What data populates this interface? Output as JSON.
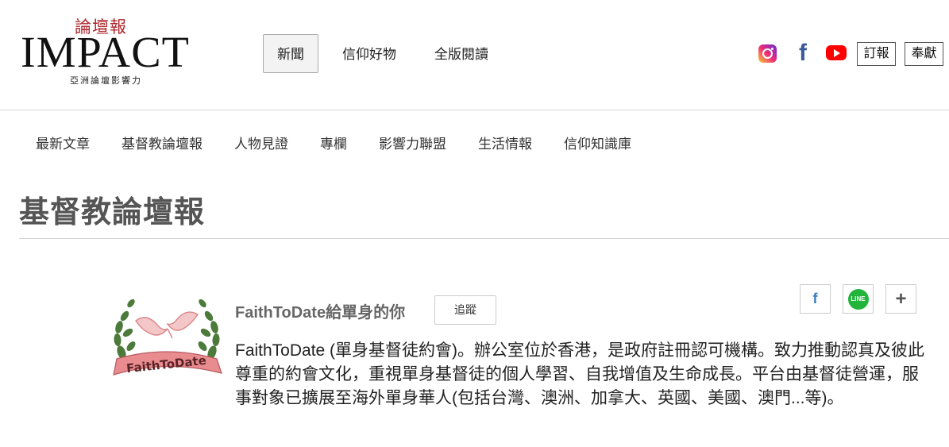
{
  "brand": {
    "chinese_name": "論壇報",
    "english_name": "IMPACT",
    "tagline": "亞洲論壇影響力"
  },
  "main_nav": [
    {
      "label": "新聞",
      "active": true
    },
    {
      "label": "信仰好物",
      "active": false
    },
    {
      "label": "全版閱讀",
      "active": false
    }
  ],
  "social_icons": [
    "instagram-icon",
    "facebook-icon",
    "youtube-icon"
  ],
  "header_buttons": {
    "subscribe": "訂報",
    "donate": "奉獻"
  },
  "sub_nav": [
    "最新文章",
    "基督教論壇報",
    "人物見證",
    "專欄",
    "影響力聯盟",
    "生活情報",
    "信仰知識庫"
  ],
  "page": {
    "title": "基督教論壇報"
  },
  "author": {
    "name": "FaithToDate給單身的你",
    "follow_label": "追蹤",
    "logo_text": "FaithToDate",
    "description": "FaithToDate (單身基督徒約會)。辦公室位於香港，是政府註冊認可機構。致力推動認真及彼此尊重的約會文化，重視單身基督徒的個人學習、自我增值及生命成長。平台由基督徒營運，服事對象已擴展至海外單身華人(包括台灣、澳洲、加拿大、英國、美國、澳門...等)。"
  },
  "share": {
    "facebook": "f",
    "line": "LINE",
    "more": "+"
  },
  "colors": {
    "brand_red": "#b0262b",
    "facebook_blue": "#3b5998",
    "youtube_red": "#ff0000",
    "line_green": "#23b53b",
    "title_gray": "#555555"
  }
}
